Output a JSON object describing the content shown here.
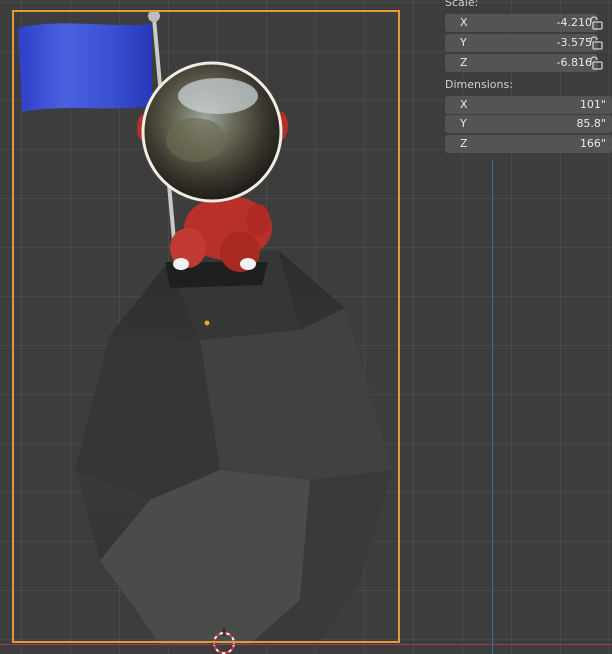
{
  "viewport": {
    "scene": "viewport-3d",
    "objects": [
      "flag",
      "flag-pole",
      "astronaut-helmet",
      "astronaut-body",
      "rock",
      "3d-cursor",
      "object-origin"
    ]
  },
  "properties_panel": {
    "scale": {
      "label": "Scale:",
      "x": {
        "axis": "X",
        "value": "-4.210"
      },
      "y": {
        "axis": "Y",
        "value": "-3.575"
      },
      "z": {
        "axis": "Z",
        "value": "-6.816"
      }
    },
    "dimensions": {
      "label": "Dimensions:",
      "x": {
        "axis": "X",
        "value": "101\""
      },
      "y": {
        "axis": "Y",
        "value": "85.8\""
      },
      "z": {
        "axis": "Z",
        "value": "166\""
      }
    }
  },
  "colors": {
    "frame": "#e69838",
    "x_axis": "#9c3b55",
    "y_axis": "#3e6aa8",
    "flag": "#3a4fd0",
    "astronaut": "#c0302a"
  }
}
